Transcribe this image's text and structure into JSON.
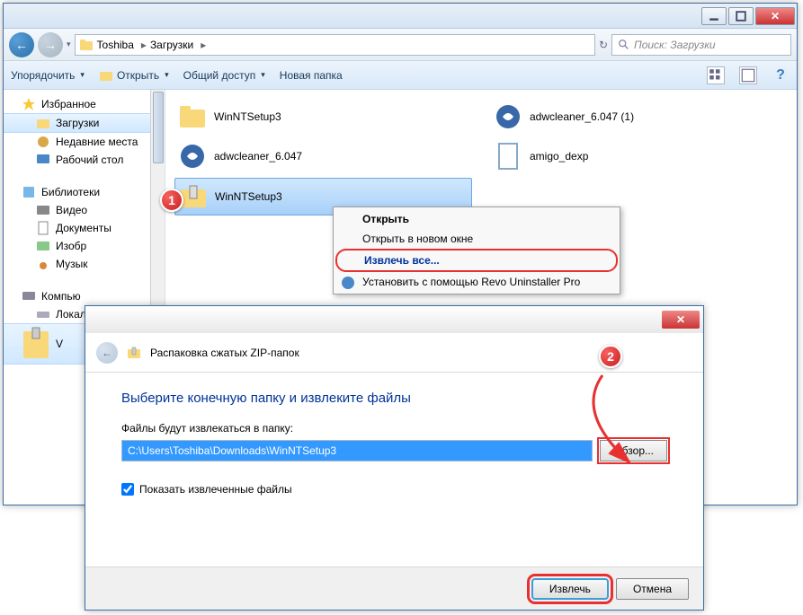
{
  "explorer": {
    "breadcrumb": [
      "Toshiba",
      "Загрузки"
    ],
    "search_placeholder": "Поиск: Загрузки",
    "toolbar": {
      "organize": "Упорядочить",
      "open": "Открыть",
      "share": "Общий доступ",
      "newfolder": "Новая папка"
    },
    "sidebar": {
      "favorites": "Избранное",
      "downloads": "Загрузки",
      "recent": "Недавние места",
      "desktop": "Рабочий стол",
      "libraries": "Библиотеки",
      "video": "Видео",
      "documents": "Документы",
      "images": "Изобр",
      "music": "Музык",
      "computer": "Компью",
      "local": "Локал",
      "selected_zip": "V"
    },
    "files": [
      {
        "name": "WinNTSetup3",
        "type": "folder"
      },
      {
        "name": "adwcleaner_6.047 (1)",
        "type": "exe"
      },
      {
        "name": "adwcleaner_6.047",
        "type": "exe"
      },
      {
        "name": "amigo_dexp",
        "type": "doc"
      },
      {
        "name": "WinNTSetup3",
        "type": "zip",
        "selected": true
      }
    ]
  },
  "contextmenu": {
    "open": "Открыть",
    "open_new": "Открыть в новом окне",
    "extract_all": "Извлечь все...",
    "revo": "Установить с помощью Revo Uninstaller Pro"
  },
  "dialog": {
    "title": "Распаковка сжатых ZIP-папок",
    "heading": "Выберите конечную папку и извлеките файлы",
    "prompt": "Файлы будут извлекаться в папку:",
    "path": "C:\\Users\\Toshiba\\Downloads\\WinNTSetup3",
    "browse": "Обзор...",
    "show_files": "Показать извлеченные файлы",
    "extract": "Извлечь",
    "cancel": "Отмена"
  },
  "badges": {
    "one": "1",
    "two": "2"
  }
}
